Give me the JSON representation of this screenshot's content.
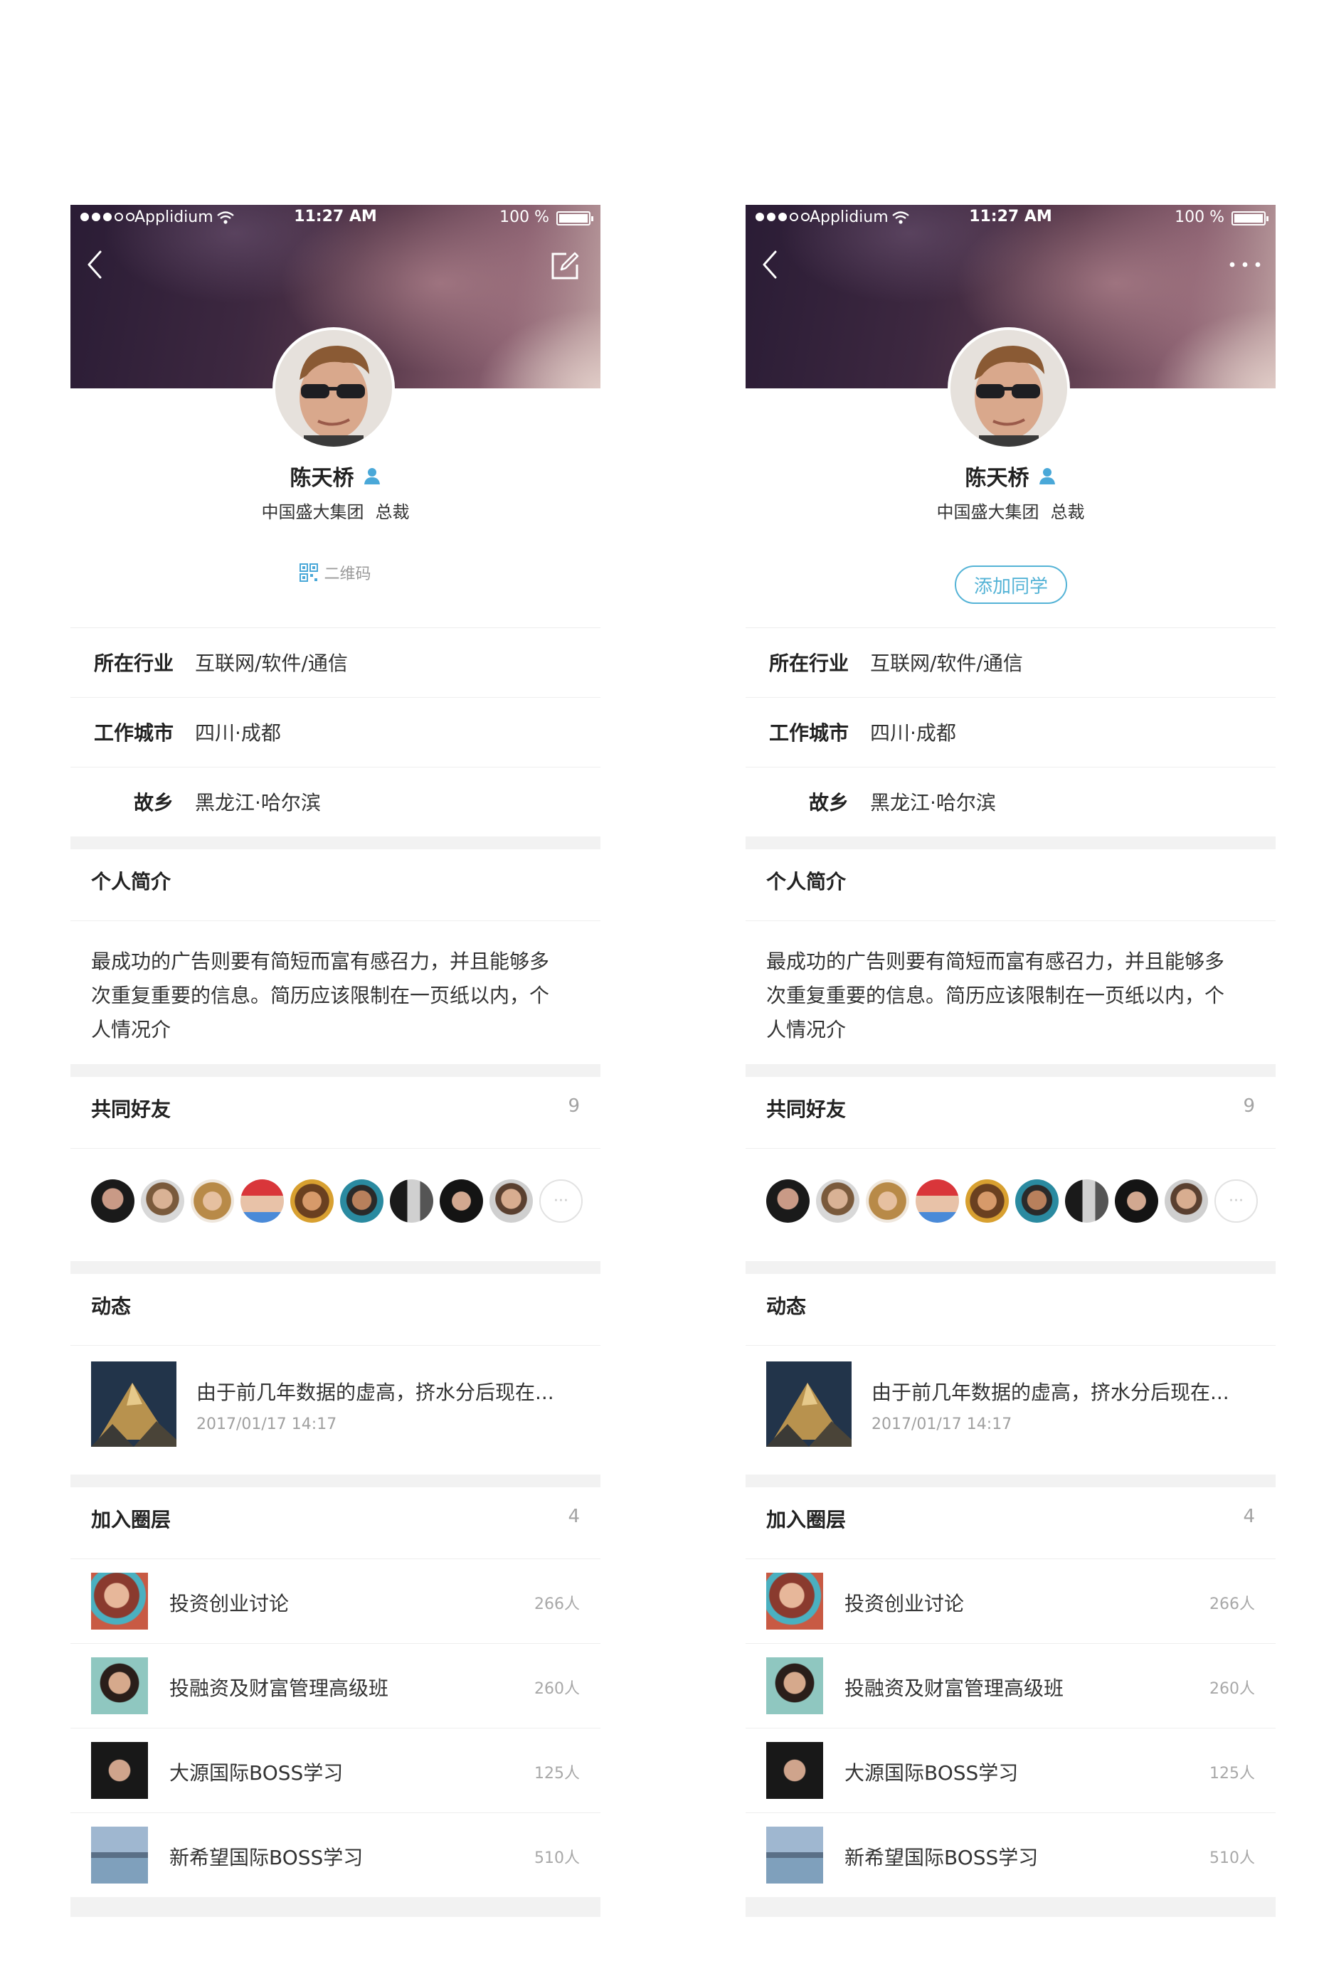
{
  "status_bar": {
    "carrier": "Applidium",
    "time": "11:27 AM",
    "battery": "100 %"
  },
  "profile": {
    "name": "陈天桥",
    "company": "中国盛大集团",
    "title": "总裁"
  },
  "left_action": {
    "qr_label": "二维码",
    "header_icon": "edit-icon"
  },
  "right_action": {
    "add_label": "添加同学",
    "header_icon": "more-icon"
  },
  "info": [
    {
      "label": "所在行业",
      "value": "互联网/软件/通信"
    },
    {
      "label": "工作城市",
      "value": "四川·成都"
    },
    {
      "label": "故乡",
      "value": "黑龙江·哈尔滨"
    }
  ],
  "bio": {
    "title": "个人简介",
    "lines": [
      "最成功的广告则要有简短而富有感召力，并且能够多",
      "次重复重要的信息。简历应该限制在一页纸以内，个",
      "人情况介"
    ]
  },
  "friends": {
    "title": "共同好友",
    "count": "9",
    "more_label": "···"
  },
  "activity": {
    "title": "动态",
    "post_title": "由于前几年数据的虚高，挤水分后现在...",
    "post_date": "2017/01/17  14:17"
  },
  "circles": {
    "title": "加入圈层",
    "count": "4",
    "items": [
      {
        "name": "投资创业讨论",
        "count": "266人"
      },
      {
        "name": "投融资及财富管理高级班",
        "count": "260人"
      },
      {
        "name": "大源国际BOSS学习",
        "count": "125人"
      },
      {
        "name": "新希望国际BOSS学习",
        "count": "510人"
      }
    ]
  },
  "colors": {
    "accent": "#54b3d6",
    "verified": "#4aa8d8",
    "gap": "#f2f2f2"
  }
}
